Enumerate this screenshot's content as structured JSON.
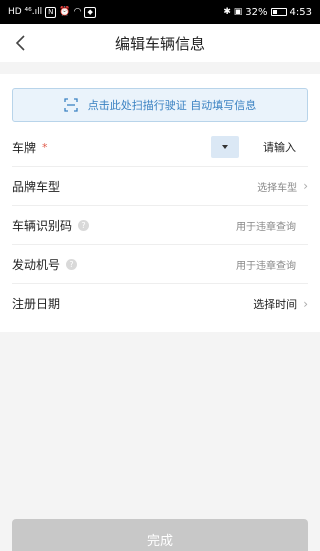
{
  "status_bar": {
    "carrier_indicators": "HD ⁴⁶.ıll",
    "right_icons": "✱ ▣",
    "battery_percent": "32%",
    "time": "4:53"
  },
  "nav": {
    "title": "编辑车辆信息"
  },
  "scan_banner": {
    "text": "点击此处扫描行驶证 自动填写信息"
  },
  "form": {
    "plate": {
      "label": "车牌",
      "required_mark": "*",
      "placeholder": "请输入"
    },
    "brand_model": {
      "label": "品牌车型",
      "value": "选择车型"
    },
    "vin": {
      "label": "车辆识别码",
      "hint": "用于违章查询"
    },
    "engine_no": {
      "label": "发动机号",
      "hint": "用于违章查询"
    },
    "register_date": {
      "label": "注册日期",
      "value": "选择时间"
    }
  },
  "footer": {
    "done_label": "完成"
  },
  "colors": {
    "accent": "#3a82c2",
    "required": "#e05a4a",
    "disabled_button": "#c8c8c8"
  }
}
